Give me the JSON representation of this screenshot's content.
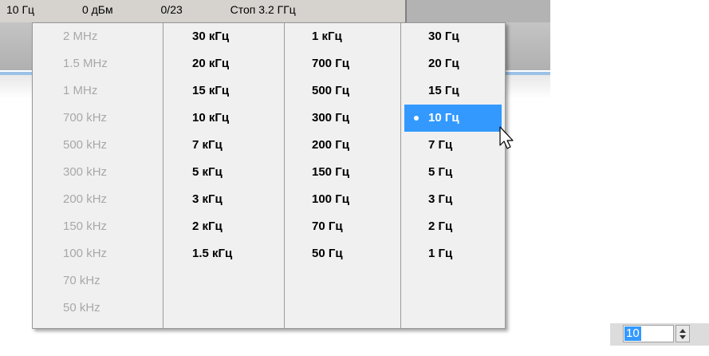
{
  "statusbar": {
    "field1": "10 Гц",
    "field2": "0 дБм",
    "field3": "0/23",
    "field4": "Стоп 3.2 ГГц"
  },
  "menu": {
    "mhz_column": [
      "2 MHz",
      "1.5 MHz",
      "1 MHz",
      "700 kHz",
      "500 kHz",
      "300 kHz",
      "200 kHz",
      "150 kHz",
      "100 kHz",
      "70 kHz",
      "50 kHz"
    ],
    "khz_column": [
      "30 кГц",
      "20 кГц",
      "15 кГц",
      "10 кГц",
      "7 кГц",
      "5 кГц",
      "3 кГц",
      "2 кГц",
      "1.5 кГц"
    ],
    "hz_column": [
      "1 кГц",
      "700 Гц",
      "500 Гц",
      "300 Гц",
      "200 Гц",
      "150 Гц",
      "100 Гц",
      "70 Гц",
      "50 Гц"
    ],
    "lowhz_column": [
      "30 Гц",
      "20 Гц",
      "15 Гц",
      "10 Гц",
      "7 Гц",
      "5 Гц",
      "3 Гц",
      "2 Гц",
      "1 Гц"
    ],
    "selected": "10 Гц"
  },
  "spinbox": {
    "value": "10"
  },
  "colors": {
    "highlight": "#3399ff",
    "disabled_text": "#a8a8a8",
    "menu_bg": "#f0f0f0"
  },
  "icons": {
    "cursor": "arrow-cursor-icon",
    "spin_up": "spin-up-icon",
    "spin_down": "spin-down-icon",
    "bullet": "radio-bullet-icon"
  }
}
